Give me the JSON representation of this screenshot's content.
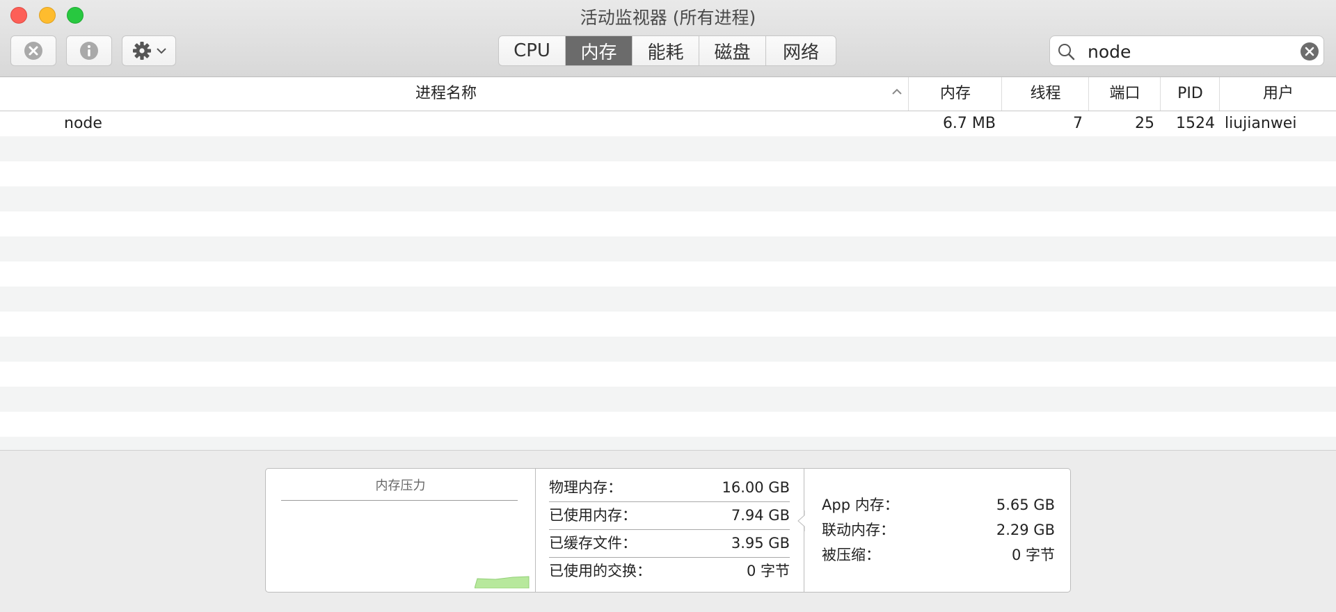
{
  "window": {
    "title": "活动监视器 (所有进程)"
  },
  "toolbar": {
    "stop_icon": "stop-process-icon",
    "info_icon": "info-icon",
    "gear_icon": "gear-icon"
  },
  "tabs": [
    {
      "label": "CPU",
      "active": false
    },
    {
      "label": "内存",
      "active": true
    },
    {
      "label": "能耗",
      "active": false
    },
    {
      "label": "磁盘",
      "active": false
    },
    {
      "label": "网络",
      "active": false
    }
  ],
  "search": {
    "value": "node"
  },
  "table": {
    "columns": {
      "name": "进程名称",
      "memory": "内存",
      "threads": "线程",
      "ports": "端口",
      "pid": "PID",
      "user": "用户"
    },
    "sort": "ascending",
    "rows": [
      {
        "name": "node",
        "memory": "6.7 MB",
        "threads": "7",
        "ports": "25",
        "pid": "1524",
        "user": "liujianwei"
      }
    ]
  },
  "memory_summary": {
    "pressure_label": "内存压力",
    "accent_color": "#b7e89c",
    "physical_label": "物理内存：",
    "physical_value": "16.00 GB",
    "used_label": "已使用内存：",
    "used_value": "7.94 GB",
    "cached_label": "已缓存文件：",
    "cached_value": "3.95 GB",
    "swap_label": "已使用的交换：",
    "swap_value": "0 字节",
    "app_label": "App 内存：",
    "app_value": "5.65 GB",
    "wired_label": "联动内存：",
    "wired_value": "2.29 GB",
    "compressed_label": "被压缩：",
    "compressed_value": "0 字节"
  }
}
